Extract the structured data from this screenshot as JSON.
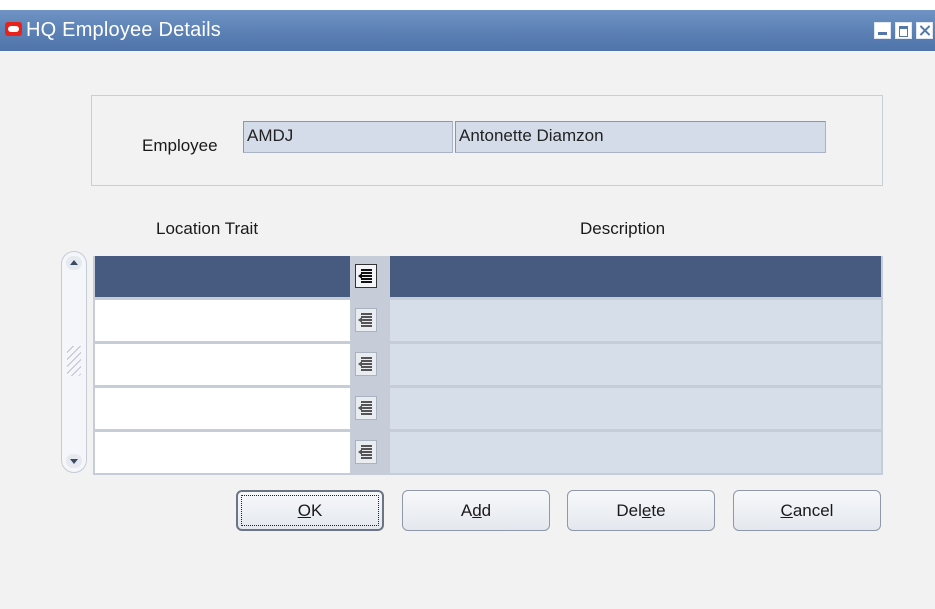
{
  "window": {
    "title": "HQ Employee Details",
    "controls": [
      "minimize-icon",
      "maximize-icon",
      "close-icon"
    ]
  },
  "employee": {
    "label": "Employee",
    "id_value": "AMDJ",
    "name_value": "Antonette Diamzon"
  },
  "table": {
    "columns": [
      "Location Trait",
      "Description"
    ],
    "rows": [
      {
        "trait": "",
        "description": "",
        "selected": true
      },
      {
        "trait": "",
        "description": "",
        "selected": false
      },
      {
        "trait": "",
        "description": "",
        "selected": false
      },
      {
        "trait": "",
        "description": "",
        "selected": false
      },
      {
        "trait": "",
        "description": "",
        "selected": false
      }
    ]
  },
  "buttons": {
    "ok": {
      "pre": "",
      "mnemonic": "O",
      "post": "K"
    },
    "add": {
      "pre": "A",
      "mnemonic": "d",
      "post": "d"
    },
    "delete": {
      "pre": "Del",
      "mnemonic": "e",
      "post": "te"
    },
    "cancel": {
      "pre": "",
      "mnemonic": "C",
      "post": "ancel"
    }
  },
  "colors": {
    "titlebar": "#5b80b4",
    "selected_row": "#475a80",
    "field_bg": "#d5dce9",
    "desc_cell_bg": "#d6deea"
  }
}
